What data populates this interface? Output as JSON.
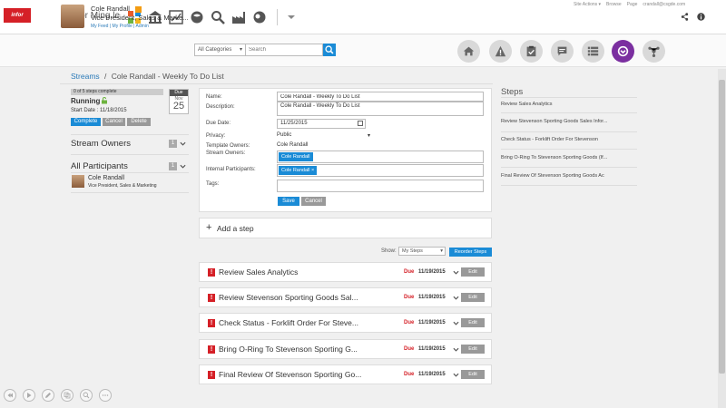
{
  "app": {
    "logo_text": "infor",
    "title": "Infor Ming.le"
  },
  "top_links": [
    "Site Actions ▾",
    "Browse",
    "Page",
    "crandall@csgde.com"
  ],
  "user": {
    "name": "Cole Randall",
    "title": "Vice President, Sales & Marke...",
    "links": "My Feed  |  My Profile  |  Admin"
  },
  "search": {
    "category": "All Categories",
    "placeholder": "Search"
  },
  "breadcrumb": {
    "root": "Streams",
    "separator": "/",
    "current": "Cole Randall - Weekly To Do List"
  },
  "status": {
    "progress_text": "0 of 5 steps complete",
    "state": "Running",
    "start_date": "Start Date : 11/18/2015",
    "due_header": "Due",
    "due_month": "Nov",
    "due_day": "25"
  },
  "actions": {
    "complete": "Complete",
    "cancel": "Cancel",
    "delete": "Delete"
  },
  "stream_owners": {
    "label": "Stream Owners",
    "count": "1"
  },
  "all_participants": {
    "label": "All Participants",
    "count": "1",
    "person_name": "Cole Randall",
    "person_title": "Vice President, Sales & Marketing"
  },
  "form": {
    "name_label": "Name:",
    "name_value": "Cole Randall - Weekly To Do List",
    "desc_label": "Description:",
    "desc_value": "Cole Randall - Weekly To Do List",
    "due_label": "Due Date:",
    "due_value": "11/25/2015",
    "privacy_label": "Privacy:",
    "privacy_value": "Public",
    "template_owners_label": "Template Owners:",
    "template_owners_value": "Cole Randall",
    "stream_owners_label": "Stream Owners:",
    "stream_owner_chip": "Cole Randall",
    "internal_label": "Internal Participants:",
    "internal_chip": "Cole Randall ×",
    "tags_label": "Tags:",
    "save": "Save",
    "cancel": "Cancel"
  },
  "add_step": {
    "plus": "+",
    "label": "Add a step"
  },
  "filter": {
    "show_label": "Show:",
    "show_value": "My Steps",
    "reorder": "Reorder Steps"
  },
  "steps": [
    {
      "name": "Review Sales Analytics",
      "due": "Due",
      "date": "11/19/2015",
      "edit": "Edit"
    },
    {
      "name": "Review Stevenson Sporting Goods Sal...",
      "due": "Due",
      "date": "11/19/2015",
      "edit": "Edit"
    },
    {
      "name": "Check Status - Forklift Order For Steve...",
      "due": "Due",
      "date": "11/19/2015",
      "edit": "Edit"
    },
    {
      "name": "Bring O-Ring To Stevenson Sporting G...",
      "due": "Due",
      "date": "11/19/2015",
      "edit": "Edit"
    },
    {
      "name": "Final Review Of Stevenson Sporting Go...",
      "due": "Due",
      "date": "11/19/2015",
      "edit": "Edit"
    }
  ],
  "steps_panel": {
    "title": "Steps",
    "items": [
      "Review Sales Analytics",
      "Review Stevenson Sporting Goods Sales Infor...",
      "Check Status - Forklift Order For Stevenson",
      "Bring O-Ring To Stevenson Sporting Goods (If...",
      "Final Review Of Stevenson Sporting Goods Ac"
    ]
  },
  "icons": {
    "nav": [
      "home-icon",
      "alert-icon",
      "tasks-icon",
      "notes-icon",
      "list-icon",
      "streams-icon",
      "share-network-icon"
    ],
    "player": [
      "rewind-icon",
      "play-icon",
      "edit-icon",
      "copy-icon",
      "zoom-icon",
      "more-icon"
    ]
  },
  "colors": {
    "accent": "#1a8bd6",
    "brand": "#d52027",
    "active_nav": "#7b2fa0"
  }
}
